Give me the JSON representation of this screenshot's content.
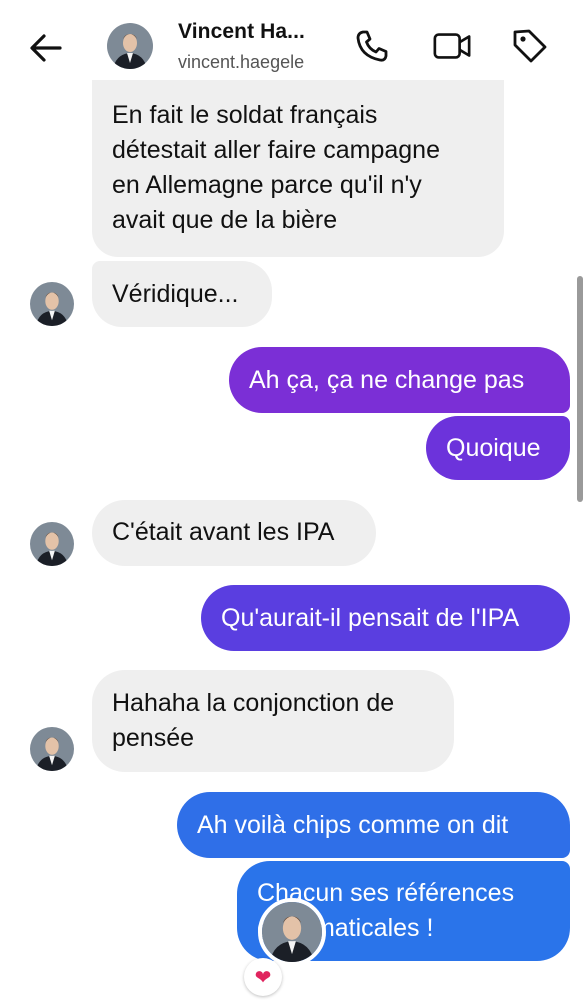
{
  "header": {
    "name": "Vincent Ha...",
    "username": "vincent.haegele"
  },
  "icons": {
    "back": "arrow-left-icon",
    "call": "phone-icon",
    "video": "video-camera-icon",
    "tag": "tag-icon",
    "reaction": "heart-icon"
  },
  "colors": {
    "incoming": "#efefef",
    "purple": "#7b2fd6",
    "indigo": "#5a3ee0",
    "blue": "#2f6fe8",
    "reaction_heart": "#e0245e"
  },
  "messages": [
    {
      "dir": "in",
      "text": "En fait le soldat français\ndétestait aller faire campagne\nen Allemagne parce qu'il n'y\navait que de la bière"
    },
    {
      "dir": "in",
      "text": "Véridique..."
    },
    {
      "dir": "out",
      "text": "Ah ça, ça ne change pas"
    },
    {
      "dir": "out",
      "text": "Quoique"
    },
    {
      "dir": "in",
      "text": "C'était avant les IPA"
    },
    {
      "dir": "out",
      "text": "Qu'aurait-il pensait de l'IPA"
    },
    {
      "dir": "in",
      "text": "Hahaha la conjonction de\npensée"
    },
    {
      "dir": "out",
      "text": "Ah voilà chips comme on dit"
    },
    {
      "dir": "out",
      "text": "Chacun ses références\ngrammaticales !"
    }
  ],
  "reaction": "❤"
}
